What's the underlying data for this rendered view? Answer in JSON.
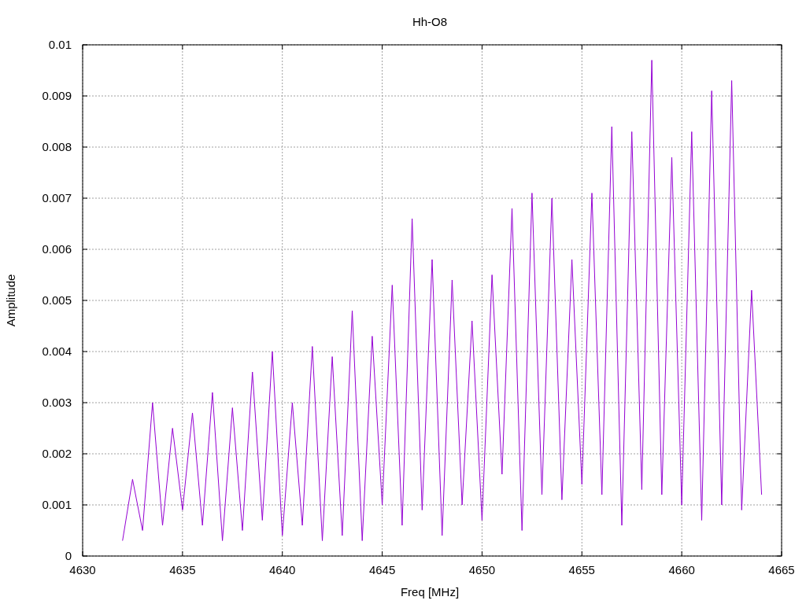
{
  "chart_data": {
    "type": "line",
    "grid": true,
    "title": "Hh-O8",
    "xlabel": "Freq [MHz]",
    "ylabel": "Amplitude",
    "xlim": [
      4630,
      4665
    ],
    "ylim": [
      0,
      0.01
    ],
    "xticks": [
      4630,
      4635,
      4640,
      4645,
      4650,
      4655,
      4660,
      4665
    ],
    "yticks": [
      0,
      0.001,
      0.002,
      0.003,
      0.004,
      0.005,
      0.006,
      0.007,
      0.008,
      0.009,
      {
        "value": 0.01,
        "label": "0.01"
      }
    ],
    "x": [
      4632,
      4632.5,
      4633,
      4633.5,
      4634,
      4634.5,
      4635,
      4635.5,
      4636,
      4636.5,
      4637,
      4637.5,
      4638,
      4638.5,
      4639,
      4639.5,
      4640,
      4640.5,
      4641,
      4641.5,
      4642,
      4642.5,
      4643,
      4643.5,
      4644,
      4644.5,
      4645,
      4645.5,
      4646,
      4646.5,
      4647,
      4647.5,
      4648,
      4648.5,
      4649,
      4649.5,
      4650,
      4650.5,
      4651,
      4651.5,
      4652,
      4652.5,
      4653,
      4653.5,
      4654,
      4654.5,
      4655,
      4655.5,
      4656,
      4656.5,
      4657,
      4657.5,
      4658,
      4658.5,
      4659,
      4659.5,
      4660,
      4660.5,
      4661,
      4661.5,
      4662,
      4662.5,
      4663,
      4663.5,
      4664
    ],
    "series": [
      {
        "color": "#9400d3",
        "values": [
          0.0003,
          0.0015,
          0.0005,
          0.003,
          0.0006,
          0.0025,
          0.0009,
          0.0028,
          0.0006,
          0.0032,
          0.0003,
          0.0029,
          0.0005,
          0.0036,
          0.0007,
          0.004,
          0.0004,
          0.003,
          0.0006,
          0.0041,
          0.0003,
          0.0039,
          0.0004,
          0.0048,
          0.0003,
          0.0043,
          0.001,
          0.0053,
          0.0006,
          0.0066,
          0.0009,
          0.0058,
          0.0004,
          0.0054,
          0.001,
          0.0046,
          0.0007,
          0.0055,
          0.0016,
          0.0068,
          0.0005,
          0.0071,
          0.0012,
          0.007,
          0.0011,
          0.0058,
          0.0014,
          0.0071,
          0.0012,
          0.0084,
          0.0006,
          0.0083,
          0.0013,
          0.0097,
          0.0012,
          0.0078,
          0.001,
          0.0083,
          0.0007,
          0.0091,
          0.001,
          0.0093,
          0.0009,
          0.0052,
          0.0012
        ]
      }
    ]
  }
}
